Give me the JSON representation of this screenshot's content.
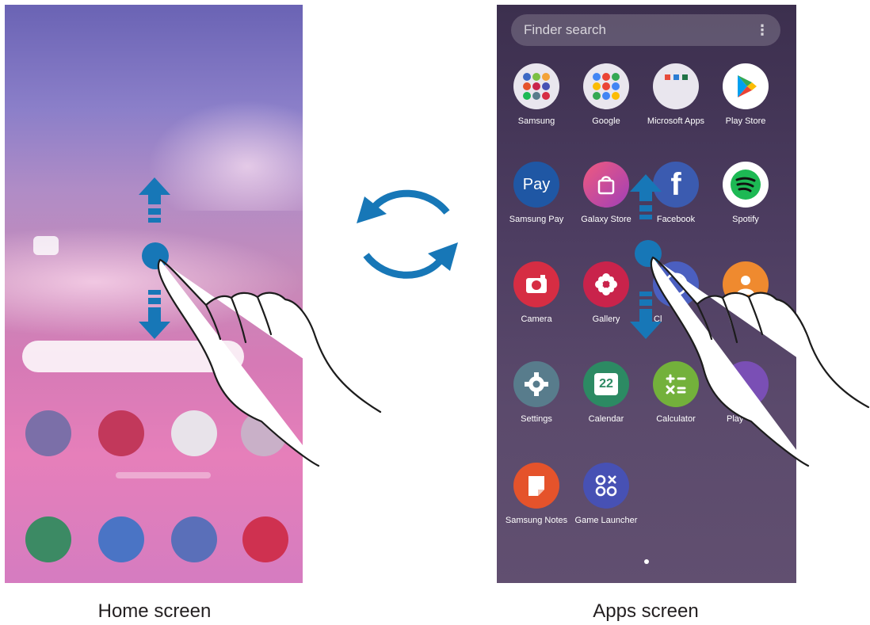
{
  "captions": {
    "home": "Home screen",
    "apps": "Apps screen"
  },
  "apps_screen": {
    "search_placeholder": "Finder search",
    "menu_icon": "more-vertical-icon",
    "apps": [
      {
        "label": "Samsung",
        "icon": "samsung-folder-icon"
      },
      {
        "label": "Google",
        "icon": "google-folder-icon"
      },
      {
        "label": "Microsoft Apps",
        "icon": "microsoft-folder-icon"
      },
      {
        "label": "Play Store",
        "icon": "play-store-icon"
      },
      {
        "label": "Samsung Pay",
        "icon": "samsung-pay-icon",
        "glyph": "Pay"
      },
      {
        "label": "Galaxy Store",
        "icon": "galaxy-store-icon"
      },
      {
        "label": "Facebook",
        "icon": "facebook-icon",
        "glyph": "f"
      },
      {
        "label": "Spotify",
        "icon": "spotify-icon"
      },
      {
        "label": "Camera",
        "icon": "camera-icon"
      },
      {
        "label": "Gallery",
        "icon": "gallery-icon"
      },
      {
        "label": "Cl",
        "icon": "clock-icon"
      },
      {
        "label": "",
        "icon": "contacts-icon"
      },
      {
        "label": "Settings",
        "icon": "settings-icon"
      },
      {
        "label": "Calendar",
        "icon": "calendar-icon",
        "glyph": "22"
      },
      {
        "label": "Calculator",
        "icon": "calculator-icon"
      },
      {
        "label": "Play",
        "icon": "play-icon"
      },
      {
        "label": "Samsung Notes",
        "icon": "samsung-notes-icon"
      },
      {
        "label": "Game Launcher",
        "icon": "game-launcher-icon"
      }
    ],
    "page_indicator": "page-dot"
  },
  "home_screen": {
    "icons": [
      "home-app-icon",
      "home-app-icon",
      "home-app-icon",
      "home-app-icon"
    ],
    "dock": [
      "phone-icon",
      "messages-icon",
      "internet-icon",
      "camera-icon"
    ]
  },
  "colors": {
    "arrow_blue": "#1777b7",
    "samsung_pay": "#1f57a4",
    "facebook": "#3b5bb0",
    "spotify": "#1db954",
    "camera": "#d62d43",
    "gallery": "#c9234b",
    "settings": "#587c8c",
    "calendar": "#2c8a63",
    "calculator": "#73b13b",
    "samsung_notes": "#e5532b",
    "game_launcher": "#4751b4"
  }
}
